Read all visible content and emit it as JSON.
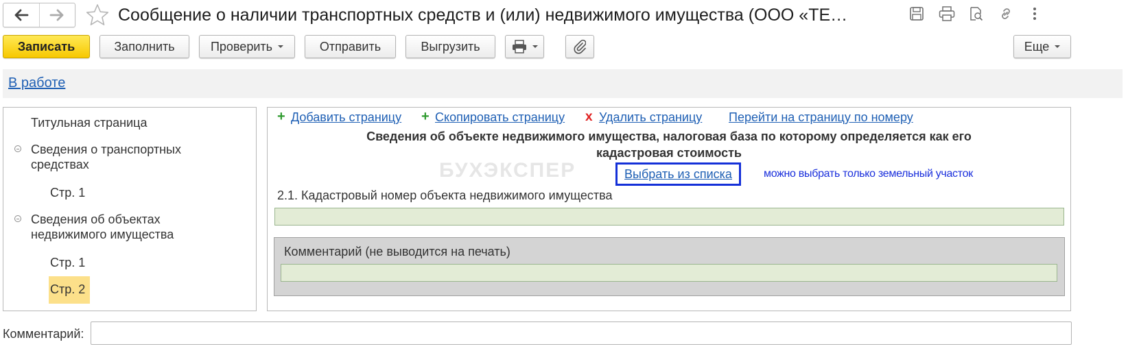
{
  "window": {
    "title": "Сообщение о наличии транспортных средств и (или) недвижимого имущества (ООО «ТЕ…"
  },
  "toolbar": {
    "save_label": "Записать",
    "fill_label": "Заполнить",
    "check_label": "Проверить",
    "send_label": "Отправить",
    "export_label": "Выгрузить",
    "more_label": "Еще"
  },
  "status": {
    "link": "В работе"
  },
  "tree": {
    "items": [
      {
        "label": "Титульная страница"
      },
      {
        "label_line1": "Сведения о транспортных",
        "label_line2": "средствах"
      },
      {
        "label": "Стр. 1"
      },
      {
        "label_line1": "Сведения об объектах",
        "label_line2": "недвижимого имущества"
      },
      {
        "label": "Стр. 1"
      },
      {
        "label": "Стр. 2"
      }
    ]
  },
  "actions": {
    "add_page": "Добавить страницу",
    "copy_page": "Скопировать страницу",
    "delete_page": "Удалить страницу",
    "goto_page": "Перейти на страницу по номеру",
    "plus_glyph": "+",
    "x_glyph": "x"
  },
  "section": {
    "title_line1": "Сведения об объекте недвижимого имущества, налоговая база по которому определяется как его",
    "title_line2": "кадастровая стоимость",
    "watermark": "БУХЭКСПЕР",
    "pick_link": "Выбрать из списка",
    "hint": "можно выбрать только земельный участок",
    "field_label": "2.1. Кадастровый номер объекта недвижимого имущества",
    "field_value": "",
    "comment_label": "Комментарий (не выводится на печать)",
    "comment_value": ""
  },
  "footer": {
    "comment_label": "Комментарий:",
    "comment_value": ""
  },
  "colors": {
    "primary_button": "#f7c800",
    "link": "#1e5fb4",
    "selected_tree_item": "#fce08a",
    "field_bg": "#e3ecd6",
    "highlight_border": "#1430d8",
    "hint_text": "#1a2fdc"
  },
  "icons": [
    "back-arrow-icon",
    "forward-arrow-icon",
    "favorite-star-icon",
    "save-disk-icon",
    "print-icon",
    "preview-icon",
    "link-icon",
    "more-vertical-icon",
    "printer-icon",
    "paperclip-icon",
    "chevron-down-icon",
    "collapse-icon"
  ]
}
